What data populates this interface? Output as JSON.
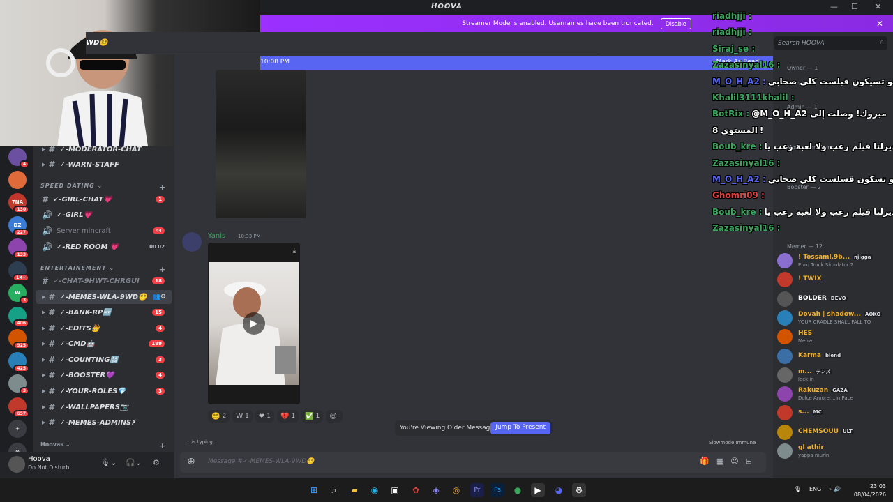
{
  "window": {
    "server_title": "HOOVA",
    "min": "—",
    "max": "☐",
    "close": "✕"
  },
  "banner": {
    "text": "Streamer Mode is enabled. Usernames have been truncated.",
    "disable_label": "Disable",
    "close": "✕"
  },
  "channel_header": {
    "name": "WD😵‍💫"
  },
  "new_messages_bar": {
    "time": "10:08 PM",
    "mark_read": "Mark As Read"
  },
  "server_rail": [
    {
      "label": "",
      "badge": "4"
    },
    {
      "label": "",
      "badge": ""
    },
    {
      "label": "7NA",
      "badge": "130"
    },
    {
      "label": "DZ",
      "badge": "227"
    },
    {
      "label": "",
      "badge": "133"
    },
    {
      "label": "",
      "badge": "1K+"
    },
    {
      "label": "W",
      "badge": "3"
    },
    {
      "label": "",
      "badge": "406"
    },
    {
      "label": "",
      "badge": "925"
    },
    {
      "label": "",
      "badge": "425"
    },
    {
      "label": "",
      "badge": "3"
    },
    {
      "label": "",
      "badge": "657"
    },
    {
      "label": "+",
      "badge": ""
    },
    {
      "label": "⊙",
      "badge": ""
    }
  ],
  "channels": {
    "top": [
      {
        "name": "✓-MODERATOR-CHAT",
        "count": ""
      },
      {
        "name": "✓-WARN-STAFF",
        "count": ""
      }
    ],
    "cat_speed": "SPEED DATING",
    "speed": [
      {
        "icon": "#",
        "name": "✓-GIRL-CHAT💗",
        "count": "1"
      },
      {
        "icon": "🔊",
        "name": "✓-GIRL💗",
        "count": ""
      },
      {
        "icon": "🔊",
        "name": "Server mincraft",
        "count": "44"
      },
      {
        "icon": "🔊",
        "name": "✓-RED ROOM 💗",
        "count": ""
      }
    ],
    "red_room_users": "00 02",
    "cat_ent": "ENTERTAINEMENT",
    "ent": [
      {
        "name": "✓-CHAT-9HWT-CHRGUI",
        "count": "18"
      },
      {
        "name": "✓-MEMES-WLA-9WD😵‍💫",
        "count": ""
      },
      {
        "name": "✓-BANK-RP🆕",
        "count": "15"
      },
      {
        "name": "✓-EDITS👑",
        "count": "4"
      },
      {
        "name": "✓-CMD🤖",
        "count": "189"
      },
      {
        "name": "✓-COUNTING🔢",
        "count": "3"
      },
      {
        "name": "✓-BOOSTER💜",
        "count": "4"
      },
      {
        "name": "✓-YOUR-ROLES💎",
        "count": "3"
      },
      {
        "name": "✓-WALLPAPERS📷",
        "count": ""
      },
      {
        "name": "✓-MEMES-ADMINS✗",
        "count": ""
      }
    ],
    "cat_hoovas": "Hoovas"
  },
  "user": {
    "name": "Hoova",
    "status": "Do Not Disturb"
  },
  "message": {
    "author": "Yanis",
    "time": "10:33 PM"
  },
  "reactions": [
    {
      "emoji": "😵‍💫",
      "count": "2"
    },
    {
      "emoji": "W",
      "count": "1"
    },
    {
      "emoji": "❤",
      "count": "1"
    },
    {
      "emoji": "💔",
      "count": "1"
    },
    {
      "emoji": "✅",
      "count": "1"
    },
    {
      "emoji": "☺",
      "count": ""
    }
  ],
  "older": {
    "text": "You're Viewing Older Messages",
    "jump": "Jump To Present"
  },
  "typing": "... is typing...",
  "slowmode": "Slowmode Immune",
  "composer": {
    "placeholder": "Message #✓-MEMES-WLA-9WD😵‍💫"
  },
  "members": {
    "search_placeholder": "Search HOOVA",
    "categories": [
      {
        "label": "Owner — 1",
        "y": 0
      },
      {
        "label": "Admin — 1",
        "y": 1
      },
      {
        "label": "Moderator Meme",
        "y": 2
      },
      {
        "label": "Booster — 2",
        "y": 3
      },
      {
        "label": "Memer — 12",
        "y": 4
      }
    ],
    "owner": {
      "name": "Hoova"
    },
    "list": [
      {
        "name": "! Tossaml.9b...",
        "tag": "njigga",
        "sub": "Euro Truck Simulator 2",
        "color": "#f0b232"
      },
      {
        "name": "! TWIX",
        "tag": "",
        "sub": "",
        "color": "#f0b232"
      },
      {
        "name": "BOLDER",
        "tag": "DEVO",
        "sub": "",
        "color": "#ffffff"
      },
      {
        "name": "Dovah | shadow...",
        "tag": "AOKO",
        "sub": "YOUR CRADLE SHALL FALL TO I",
        "color": "#f0b232"
      },
      {
        "name": "HES",
        "tag": "",
        "sub": "Meow",
        "color": "#f0b232"
      },
      {
        "name": "Karma",
        "tag": "blend",
        "sub": "",
        "color": "#f0b232"
      },
      {
        "name": "m...",
        "tag": "テンズ",
        "sub": "lock in",
        "color": "#f0b232"
      },
      {
        "name": "Rakuzan",
        "tag": "GAZA",
        "sub": "Dolce Amore....in Pace",
        "color": "#f0b232"
      },
      {
        "name": "s...",
        "tag": "MC",
        "sub": "",
        "color": "#f0b232"
      },
      {
        "name": "CHEMSOUU",
        "tag": "ULT",
        "sub": "",
        "color": "#f0b232"
      },
      {
        "name": "gl athir",
        "tag": "",
        "sub": "yappa murin",
        "color": "#f0b232"
      }
    ]
  },
  "overlay": [
    {
      "user": "riadhjji :",
      "text": "",
      "color": "#3ba55d"
    },
    {
      "user": "riadhjji :",
      "text": "",
      "color": "#3ba55d"
    },
    {
      "user": "Siraj_se :",
      "text": "",
      "color": "#3ba55d"
    },
    {
      "user": "Zazasinyal16 :",
      "text": "",
      "color": "#3ba55d"
    },
    {
      "user": "M_O_H_A2 :",
      "text": "هو تسيكون قبلست كلي صحابي",
      "color": "#5865f2"
    },
    {
      "user": "Khalil3111khalil :",
      "text": "",
      "color": "#3ba55d"
    },
    {
      "user": "BotRix :",
      "text": "@M_O_H_A2 مبروك! وصلت إلى",
      "color": "#3ba55d"
    },
    {
      "user": "",
      "text": "المستوى 8!",
      "color": "#ffffff"
    },
    {
      "user": "Boub_kre :",
      "text": "ديرلنا فيلم رعب ولا لعبة رعب يا HOOVA",
      "color": "#3ba55d"
    },
    {
      "user": "Zazasinyal16 :",
      "text": "",
      "color": "#3ba55d"
    },
    {
      "user": "M_O_H_A2 :",
      "text": "هو تسكون قسلست كلي صحابي",
      "color": "#5865f2"
    },
    {
      "user": "Ghomri09 :",
      "text": "",
      "color": "#e04040"
    },
    {
      "user": "Boub_kre :",
      "text": "ديرلنا فيلم رعب ولا لعبة رعب يا HOOVA",
      "color": "#3ba55d"
    },
    {
      "user": "Zazasinyal16 :",
      "text": "",
      "color": "#3ba55d"
    }
  ],
  "taskbar": {
    "lang": "ENG",
    "time": "23:03",
    "date": "08/04/2026"
  }
}
